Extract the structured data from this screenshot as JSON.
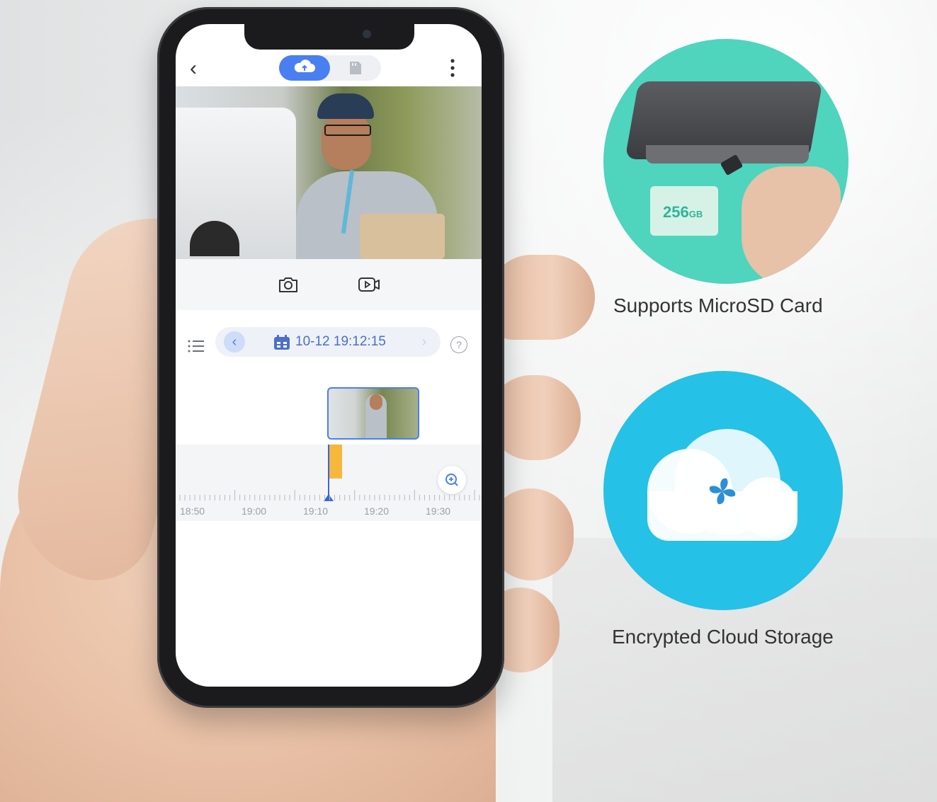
{
  "app": {
    "header": {
      "back_label": "‹",
      "tabs": [
        {
          "name": "cloud",
          "icon": "cloud-icon",
          "active": true
        },
        {
          "name": "sd-card",
          "icon": "sd-card-icon",
          "active": false
        }
      ],
      "more_icon": "more-vertical-icon"
    },
    "controls": {
      "snapshot_icon": "camera-icon",
      "record_icon": "video-record-icon"
    },
    "date_bar": {
      "prev_label": "‹",
      "next_label": "›",
      "datetime": "10-12 19:12:15",
      "help_label": "?"
    },
    "timeline": {
      "tick_labels": [
        "18:50",
        "19:00",
        "19:10",
        "19:20",
        "19:30"
      ]
    }
  },
  "features": {
    "sd": {
      "capacity_number": "256",
      "capacity_unit": "GB",
      "label": "Supports MicroSD Card"
    },
    "cloud": {
      "label": "Encrypted Cloud Storage"
    }
  },
  "colors": {
    "accent_blue": "#4a7ff2",
    "recording_orange": "#f6b73c",
    "sd_circle": "#4fd4bd",
    "cloud_circle": "#26c1e6"
  }
}
